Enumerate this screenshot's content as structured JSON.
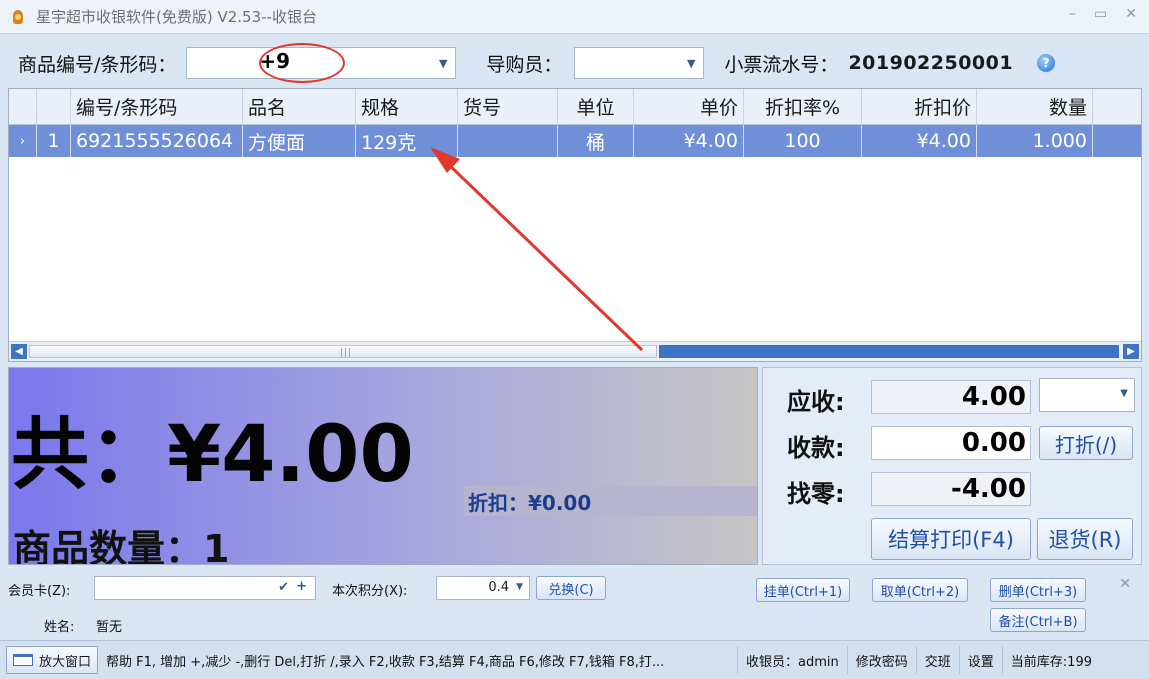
{
  "titlebar": {
    "title": "星宇超市收银软件(免费版) V2.53--收银台",
    "min_glyph": "–",
    "max_glyph": "▭",
    "close_glyph": "✕",
    "icon": "app-logo-icon"
  },
  "search": {
    "barcode_label": "商品编号/条形码：",
    "barcode_value": "+9",
    "guide_label": "导购员：",
    "guide_value": "",
    "ticket_label": "小票流水号：",
    "ticket_value": "201902250001",
    "help_icon": "?"
  },
  "grid": {
    "columns": [
      "编号/条形码",
      "品名",
      "规格",
      "货号",
      "单位",
      "单价",
      "折扣率%",
      "折扣价",
      "数量"
    ],
    "rows": [
      {
        "selector": "›",
        "index": "1",
        "barcode": "6921555526064",
        "name": "方便面",
        "spec": "129克",
        "item_no": "",
        "unit": "桶",
        "price": "¥4.00",
        "discount_rate": "100",
        "discount_price": "¥4.00",
        "quantity": "1.000"
      }
    ],
    "scroll_left_glyph": "◀",
    "scroll_right_glyph": "▶",
    "scroll_grip": "|||"
  },
  "totals": {
    "total_text": "共：¥4.00",
    "discount_text": "折扣：¥0.00",
    "quantity_text": "商品数量：1"
  },
  "payment": {
    "receivable_label": "应收:",
    "receivable_value": "4.00",
    "received_label": "收款:",
    "received_value": "0.00",
    "change_label": "找零:",
    "change_value": "-4.00",
    "discount_button": "打折(/)",
    "settle_button": "结算打印(F4)",
    "return_button": "退货(R)"
  },
  "member": {
    "card_label": "会员卡(Z):",
    "card_value": "",
    "check_glyph": "✔",
    "plus_glyph": "+",
    "points_label": "本次积分(X):",
    "points_value": "0.4",
    "redeem_button": "兑换(C)",
    "name_label": "姓名:",
    "name_value": "暂无",
    "hold_button": "挂单(Ctrl+1)",
    "take_button": "取单(Ctrl+2)",
    "delete_button": "删单(Ctrl+3)",
    "note_button": "备注(Ctrl+B)",
    "close_glyph": "✕"
  },
  "statusbar": {
    "zoom_button": "放大窗口",
    "help_text": "帮助 F1, 增加 +,减少 -,删行 Del,打折 /,录入 F2,收款 F3,结算 F4,商品 F6,修改 F7,钱箱 F8,打...",
    "cashier": "收银员：admin",
    "change_password": "修改密码",
    "shift": "交班",
    "settings": "设置",
    "stock": "当前库存:199"
  }
}
